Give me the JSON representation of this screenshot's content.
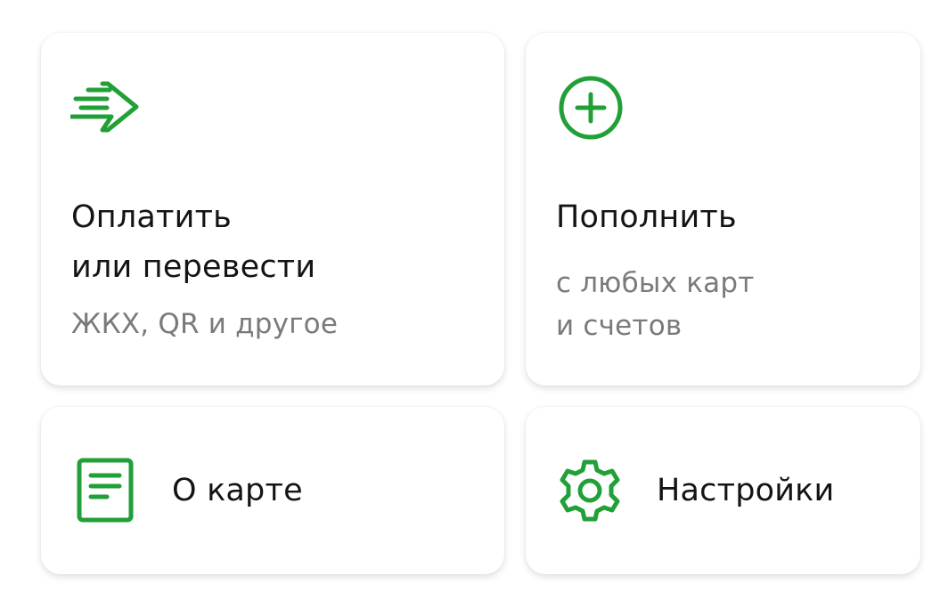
{
  "accent_color": "#21a038",
  "cards": {
    "pay": {
      "icon": "send-arrow-icon",
      "title_line1": "Оплатить",
      "title_line2": "или перевести",
      "subtitle": "ЖКХ, QR и другое"
    },
    "topup": {
      "icon": "plus-circle-icon",
      "title": "Пополнить",
      "subtitle_line1": "с любых карт",
      "subtitle_line2": "и счетов"
    },
    "about": {
      "icon": "document-icon",
      "label": "О карте"
    },
    "settings": {
      "icon": "gear-icon",
      "label": "Настройки"
    }
  }
}
